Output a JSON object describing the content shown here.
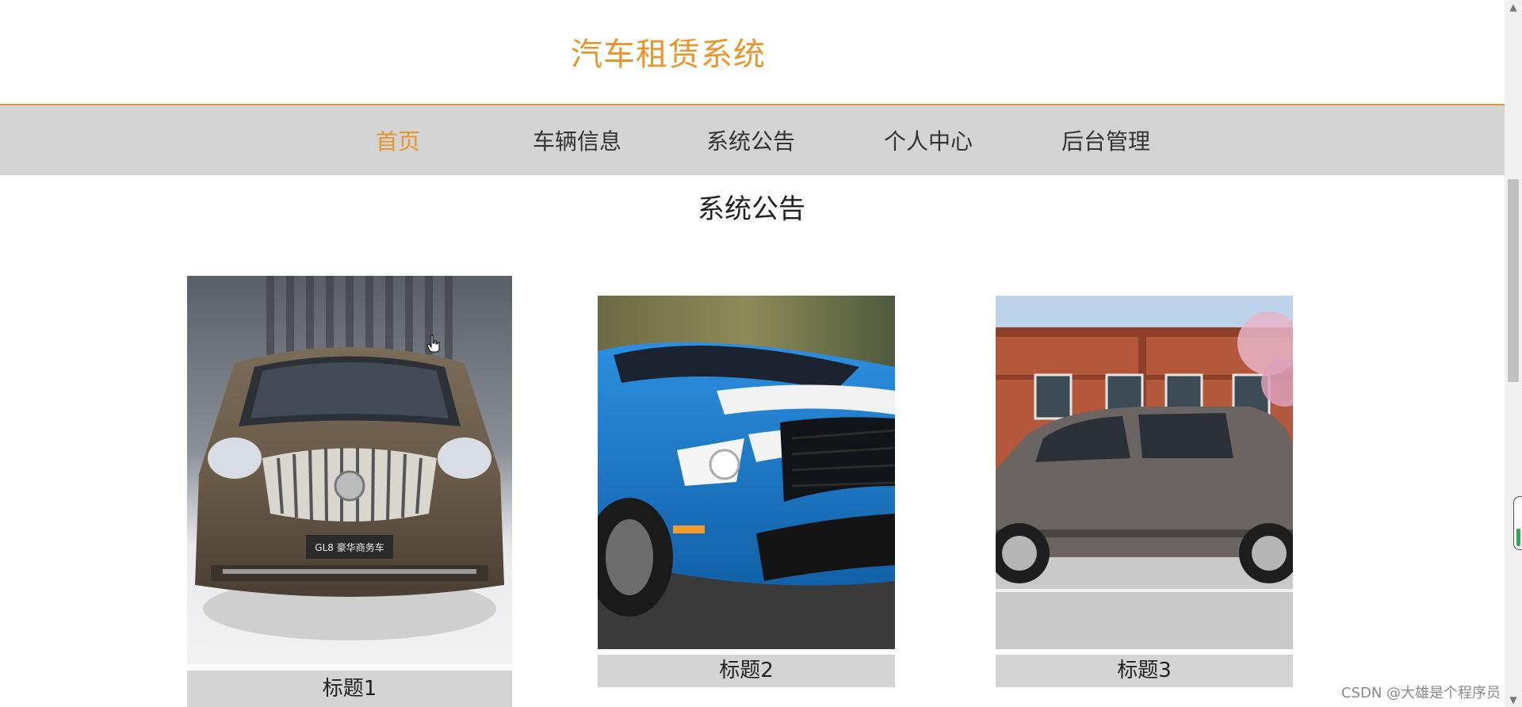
{
  "header": {
    "title": "汽车租赁系统",
    "accent_color": "#e8952c"
  },
  "nav": {
    "items": [
      {
        "label": "首页",
        "active": true
      },
      {
        "label": "车辆信息",
        "active": false
      },
      {
        "label": "系统公告",
        "active": false
      },
      {
        "label": "个人中心",
        "active": false
      },
      {
        "label": "后台管理",
        "active": false
      }
    ]
  },
  "section": {
    "heading": "系统公告"
  },
  "cards": [
    {
      "caption": "标题1",
      "image": "brown-minivan-front-photo",
      "badge": "GL8 豪华商务车"
    },
    {
      "caption": "标题2",
      "image": "blue-sports-car-photo"
    },
    {
      "caption": "标题3",
      "image": "grey-minivan-side-photo"
    }
  ],
  "watermark": "CSDN @大雄是个程序员"
}
